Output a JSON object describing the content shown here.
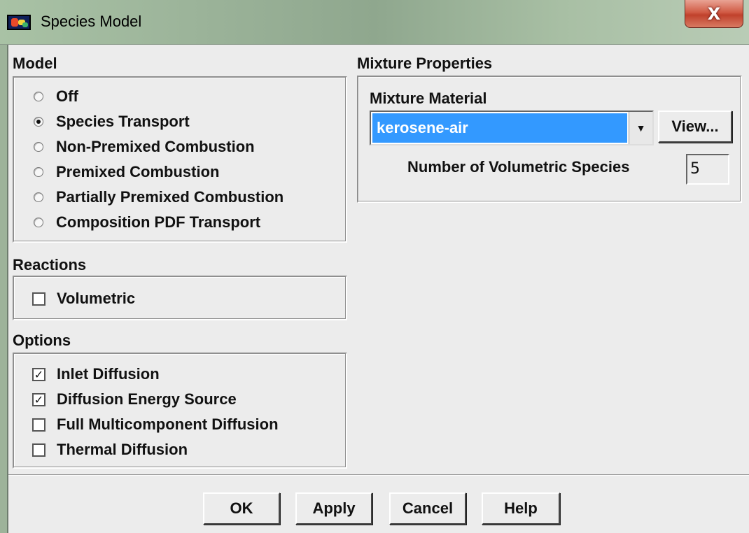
{
  "window": {
    "title": "Species Model",
    "close_glyph": "X"
  },
  "model": {
    "title": "Model",
    "options": [
      {
        "label": "Off",
        "selected": false
      },
      {
        "label": "Species Transport",
        "selected": true
      },
      {
        "label": "Non-Premixed Combustion",
        "selected": false
      },
      {
        "label": "Premixed Combustion",
        "selected": false
      },
      {
        "label": "Partially Premixed Combustion",
        "selected": false
      },
      {
        "label": "Composition PDF Transport",
        "selected": false
      }
    ]
  },
  "reactions": {
    "title": "Reactions",
    "items": [
      {
        "label": "Volumetric",
        "checked": false
      }
    ]
  },
  "options_group": {
    "title": "Options",
    "items": [
      {
        "label": "Inlet Diffusion",
        "checked": true
      },
      {
        "label": "Diffusion Energy Source",
        "checked": true
      },
      {
        "label": "Full Multicomponent Diffusion",
        "checked": false
      },
      {
        "label": "Thermal Diffusion",
        "checked": false
      }
    ]
  },
  "mixture": {
    "title": "Mixture Properties",
    "material_label": "Mixture Material",
    "material_value": "kerosene-air",
    "view_label": "View...",
    "species_label": "Number of Volumetric Species",
    "species_value": "5"
  },
  "buttons": {
    "ok": "OK",
    "apply": "Apply",
    "cancel": "Cancel",
    "help": "Help"
  },
  "colors": {
    "selection": "#3399ff",
    "dialog_bg": "#ececec",
    "close_button": "#c0412c"
  }
}
